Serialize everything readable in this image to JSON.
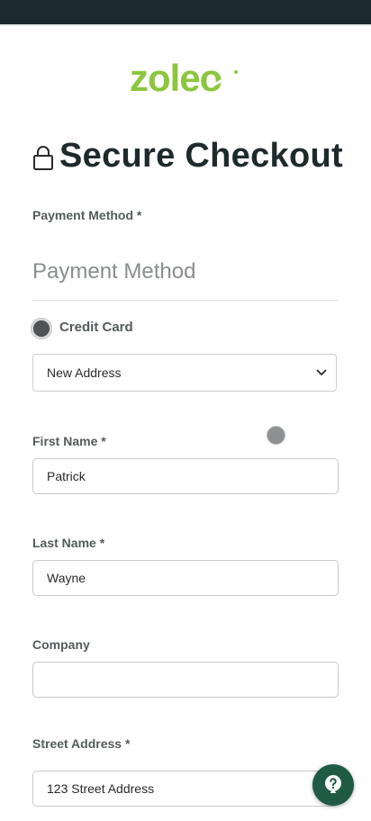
{
  "header": {
    "brand": "zoleo",
    "title": "Secure Checkout",
    "colors": {
      "topbar": "#1d2a2d",
      "logo": "#8cc63f",
      "title": "#1f2a2c"
    }
  },
  "payment": {
    "label": "Payment Method *",
    "placeholder": "Payment Method",
    "option_label": "Credit Card"
  },
  "address_select": {
    "selected": "New Address"
  },
  "form": {
    "first_name": {
      "label": "First Name *",
      "value": "Patrick"
    },
    "last_name": {
      "label": "Last Name *",
      "value": "Wayne"
    },
    "company": {
      "label": "Company",
      "value": ""
    },
    "street": {
      "label": "Street Address *",
      "value": "123 Street Address"
    }
  },
  "help": {
    "icon": "question-icon",
    "color": "#1f5a45"
  }
}
